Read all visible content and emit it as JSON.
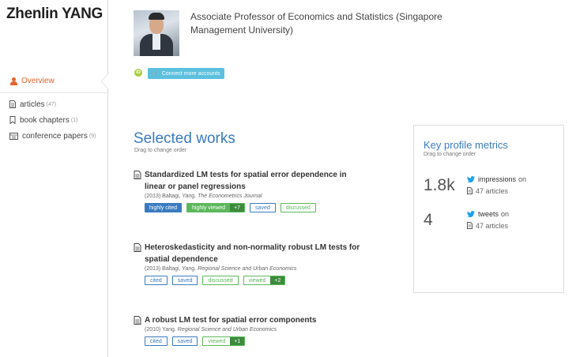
{
  "profile": {
    "name": "Zhenlin YANG",
    "affiliation": "Associate Professor of Economics and Statistics (Singapore Management University)",
    "orcid_label": "iD",
    "connect_label": "Connect more accounts"
  },
  "sidebar": {
    "overview_label": "Overview",
    "items": [
      {
        "label": "articles",
        "count": "(47)",
        "icon": "document-icon"
      },
      {
        "label": "book chapters",
        "count": "(1)",
        "icon": "bookmark-icon"
      },
      {
        "label": "conference papers",
        "count": "(9)",
        "icon": "presentation-icon"
      }
    ]
  },
  "selected_works": {
    "title": "Selected works",
    "subtitle": "Drag to change order",
    "works": [
      {
        "title": "Standardized LM tests for spatial error dependence in linear or panel regressions",
        "meta": "(2013) Baltagi, Yang.",
        "journal": "The Econometrics Journal",
        "badges": [
          {
            "type": "solid-blue",
            "label": "highly cited"
          },
          {
            "type": "split-green filled",
            "label": "highly viewed",
            "num": "+7"
          },
          {
            "type": "outline-blue",
            "label": "saved"
          },
          {
            "type": "outline-green",
            "label": "discussed"
          }
        ]
      },
      {
        "title": "Heteroskedasticity and non-normality robust LM tests for spatial dependence",
        "meta": "(2013) Baltagi, Yang.",
        "journal": "Regional Science and Urban Economics",
        "badges": [
          {
            "type": "outline-blue",
            "label": "cited"
          },
          {
            "type": "outline-blue",
            "label": "saved"
          },
          {
            "type": "outline-green",
            "label": "discussed"
          },
          {
            "type": "split-green",
            "label": "viewed",
            "num": "+2"
          }
        ]
      },
      {
        "title": "A robust LM test for spatial error components",
        "meta": "(2010) Yang.",
        "journal": "Regional Science and Urban Economics",
        "badges": [
          {
            "type": "outline-blue",
            "label": "cited"
          },
          {
            "type": "outline-blue",
            "label": "saved"
          },
          {
            "type": "split-green",
            "label": "viewed",
            "num": "+1"
          }
        ]
      }
    ]
  },
  "metrics": {
    "title": "Key profile metrics",
    "subtitle": "Drag to change order",
    "rows": [
      {
        "value": "1.8k",
        "label": "impressions",
        "on": "on",
        "articles": "47 articles"
      },
      {
        "value": "4",
        "label": "tweets",
        "on": "on",
        "articles": "47 articles"
      }
    ]
  },
  "colors": {
    "accent_blue": "#3a7bbf",
    "overview_orange": "#e8612c",
    "green": "#5cb85c",
    "connect_button": "#5bc0de",
    "twitter": "#1da1f2"
  }
}
